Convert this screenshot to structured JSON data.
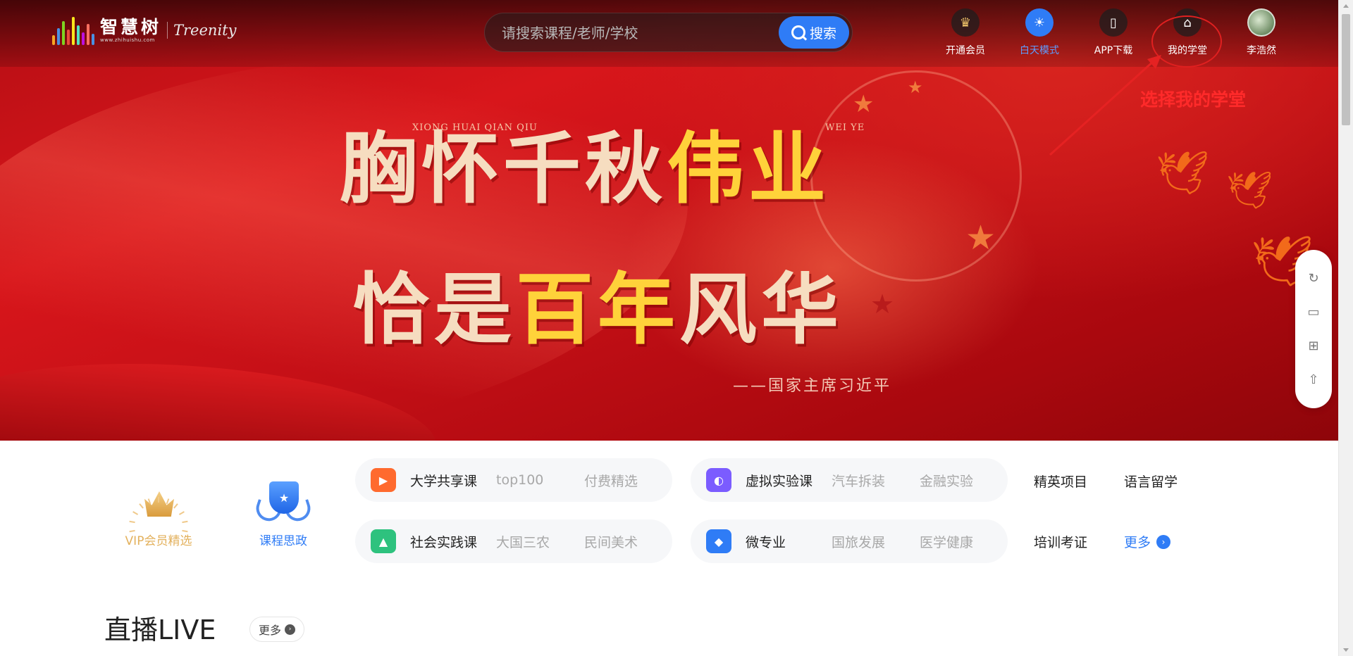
{
  "brand": {
    "name_cn": "智慧树",
    "url": "www.zhihuishu.com",
    "name_en": "Treenity",
    "bar_colors": [
      "#f5a623",
      "#4a90e2",
      "#7ed321",
      "#e94b3c",
      "#f8e71c",
      "#50e3c2",
      "#bd10e0",
      "#ff6f61",
      "#4a90e2"
    ]
  },
  "search": {
    "placeholder": "请搜索课程/老师/学校",
    "button_label": "搜索"
  },
  "nav": {
    "vip": "开通会员",
    "day_mode": "白天模式",
    "app": "APP下载",
    "my_school": "我的学堂",
    "user": "李浩然"
  },
  "annotation": {
    "text": "选择我的学堂",
    "color": "#ff2a2a"
  },
  "banner": {
    "pinyin_left": "XIONG HUAI QIAN QIU",
    "pinyin_right": "WEI YE",
    "line1_plain": "胸怀千秋",
    "line1_gold": "伟业",
    "line2_plain": "恰是",
    "line2_gold": "百年",
    "line2_end": "风华",
    "attribution": "——国家主席习近平"
  },
  "categories": {
    "vip_label": "VIP会员精选",
    "ideology_label": "课程思政",
    "row1": [
      {
        "title": "大学共享课",
        "sub1": "top100",
        "sub2": "付费精选",
        "icon": "play-icon",
        "color": "#ff6a2e"
      },
      {
        "title": "虚拟实验课",
        "sub1": "汽车拆装",
        "sub2": "金融实验",
        "icon": "vr-icon",
        "color": "#7b5cff"
      }
    ],
    "row2": [
      {
        "title": "社会实践课",
        "sub1": "大国三农",
        "sub2": "民间美术",
        "icon": "tree-icon",
        "color": "#2ec27e"
      },
      {
        "title": "微专业",
        "sub1": "国旅发展",
        "sub2": "医学健康",
        "icon": "cap-icon",
        "color": "#2f7cf6"
      }
    ],
    "links": {
      "elite": "精英项目",
      "language": "语言留学",
      "training": "培训考证",
      "more": "更多"
    }
  },
  "live": {
    "title": "直播LIVE",
    "more": "更多"
  },
  "colors": {
    "accent": "#2f7cf6",
    "banner_red": "#c30f16",
    "gold": "#ffd23a"
  }
}
